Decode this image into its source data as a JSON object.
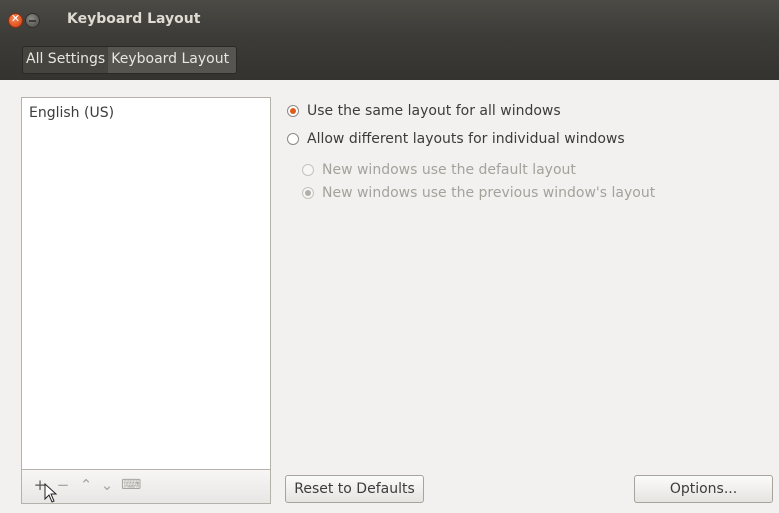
{
  "window": {
    "title": "Keyboard Layout",
    "close_glyph": "✕"
  },
  "breadcrumb": {
    "items": [
      "All Settings",
      "Keyboard Layout"
    ]
  },
  "layouts": {
    "items": [
      "English (US)"
    ],
    "toolbar": {
      "add": "+",
      "remove": "−",
      "up": "⌃",
      "down": "⌄",
      "preview": "⌨"
    }
  },
  "options": {
    "same_layout": "Use the same layout for all windows",
    "different_layouts": "Allow different layouts for individual windows",
    "new_default": "New windows use the default layout",
    "new_previous": "New windows use the previous window's layout",
    "selected": "same_layout",
    "sub_selected": "new_previous"
  },
  "buttons": {
    "reset": "Reset to Defaults",
    "options": "Options..."
  },
  "colors": {
    "accent": "#e05b1c",
    "titlebar": "#3c3b37"
  }
}
